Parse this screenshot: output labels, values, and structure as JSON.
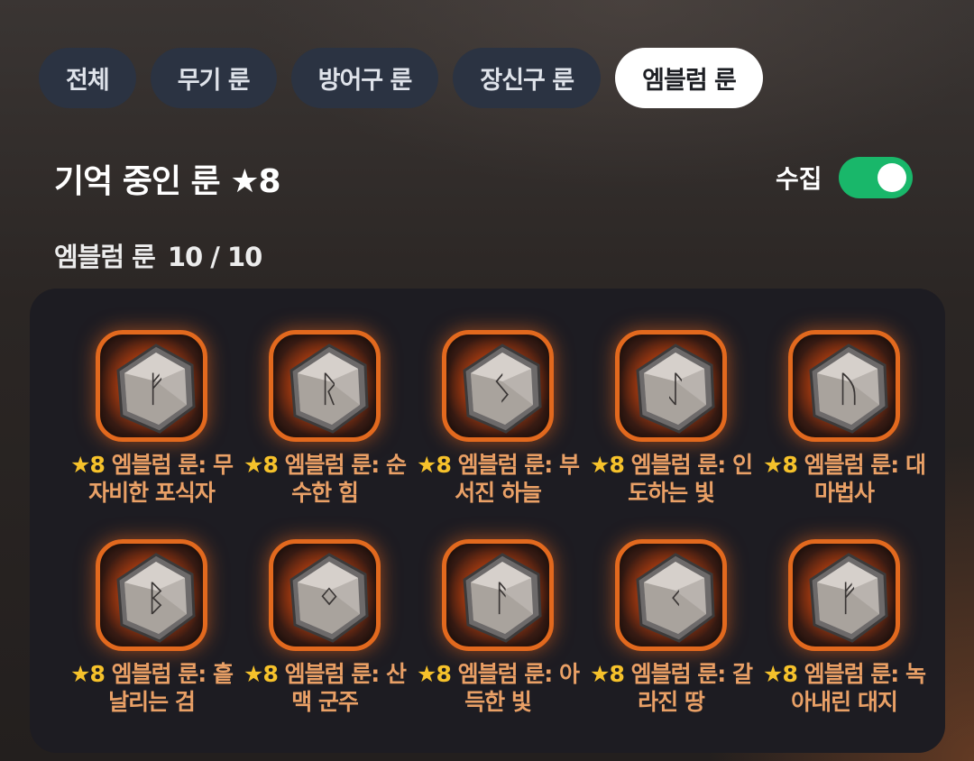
{
  "tabs": [
    {
      "label": "전체",
      "active": false
    },
    {
      "label": "무기 룬",
      "active": false
    },
    {
      "label": "방어구 룬",
      "active": false
    },
    {
      "label": "장신구 룬",
      "active": false
    },
    {
      "label": "엠블럼 룬",
      "active": true
    }
  ],
  "header": {
    "title": "기억 중인 룬 ★8",
    "collect_label": "수집",
    "collect_toggle_on": true
  },
  "section": {
    "label": "엠블럼 룬",
    "count": "10 / 10"
  },
  "runes": [
    {
      "star": "★8",
      "name": "엠블럼 룬: 무자비한 포식자",
      "glyph": "ᚠ"
    },
    {
      "star": "★8",
      "name": "엠블럼 룬: 순수한 힘",
      "glyph": "ᚱ"
    },
    {
      "star": "★8",
      "name": "엠블럼 룬: 부서진 하늘",
      "glyph": "ᛊ"
    },
    {
      "star": "★8",
      "name": "엠블럼 룬: 인도하는 빛",
      "glyph": "ᛇ"
    },
    {
      "star": "★8",
      "name": "엠블럼 룬: 대마법사",
      "glyph": "ᚢ"
    },
    {
      "star": "★8",
      "name": "엠블럼 룬: 흩날리는 검",
      "glyph": "ᛒ"
    },
    {
      "star": "★8",
      "name": "엠블럼 룬: 산맥 군주",
      "glyph": "ᛜ"
    },
    {
      "star": "★8",
      "name": "엠블럼 룬: 아득한 빛",
      "glyph": "ᚨ"
    },
    {
      "star": "★8",
      "name": "엠블럼 룬: 갈라진 땅",
      "glyph": "ᚲ"
    },
    {
      "star": "★8",
      "name": "엠블럼 룬: 녹아내린 대지",
      "glyph": "ᚠ"
    }
  ],
  "colors": {
    "accent_orange": "#e2691e",
    "star_yellow": "#f6c22b",
    "label_orange": "#e9a066",
    "toggle_green": "#19b76a",
    "tab_inactive": "#2b3342",
    "tab_active": "#ffffff"
  }
}
